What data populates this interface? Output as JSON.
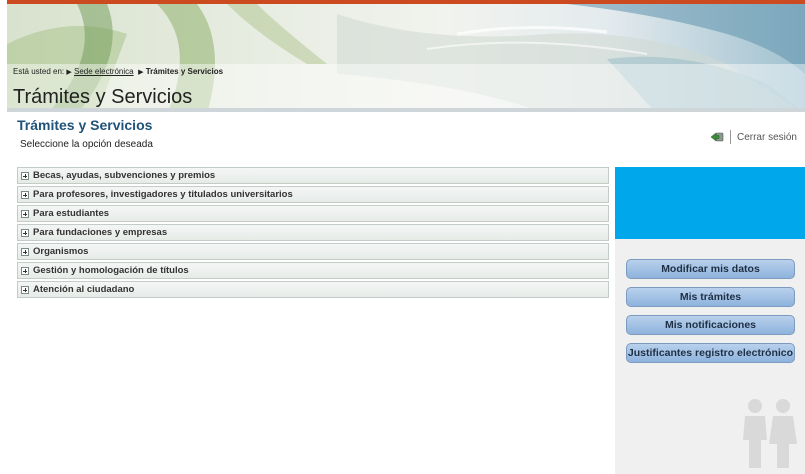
{
  "breadcrumb": {
    "prefix": "Está usted en:",
    "link": "Sede electrónica",
    "current": "Trámites y Servicios"
  },
  "banner": {
    "title": "Trámites y Servicios"
  },
  "page": {
    "heading": "Trámites y Servicios",
    "subtitle": "Seleccione la opción deseada"
  },
  "logout": {
    "label": "Cerrar sesión",
    "icon": "logout-icon"
  },
  "accordion": {
    "items": [
      {
        "label": "Becas, ayudas, subvenciones y premios"
      },
      {
        "label": "Para profesores, investigadores y titulados universitarios"
      },
      {
        "label": "Para estudiantes"
      },
      {
        "label": "Para fundaciones y empresas"
      },
      {
        "label": "Organismos"
      },
      {
        "label": "Gestión y homologación de títulos"
      },
      {
        "label": "Atención al ciudadano"
      }
    ]
  },
  "sidebar": {
    "buttons": [
      {
        "label": "Modificar mis datos"
      },
      {
        "label": "Mis trámites"
      },
      {
        "label": "Mis notificaciones"
      },
      {
        "label": "Justificantes registro electrónico"
      }
    ]
  },
  "colors": {
    "accent_orange": "#cc4a1f",
    "heading_blue": "#1f5379",
    "panel_blue": "#00a7ea",
    "button_blue": "#9fc0e4"
  }
}
